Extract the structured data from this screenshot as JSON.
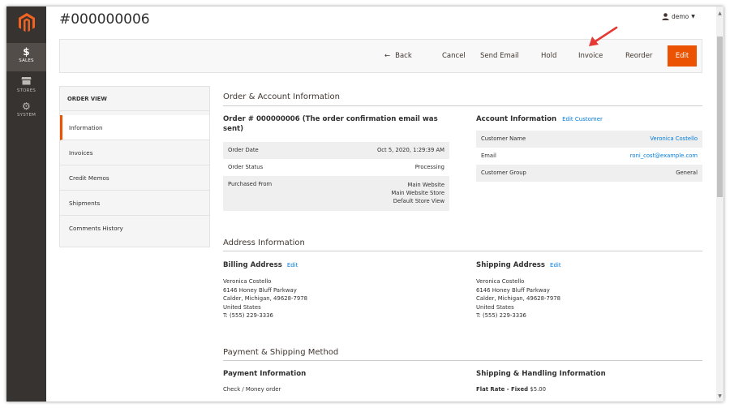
{
  "nav": {
    "items": [
      {
        "label": "SALES",
        "icon": "dollar-icon"
      },
      {
        "label": "STORES",
        "icon": "stores-icon"
      },
      {
        "label": "SYSTEM",
        "icon": "gear-icon"
      }
    ]
  },
  "header": {
    "title": "#000000006",
    "user": "demo"
  },
  "actions": {
    "back": "Back",
    "cancel": "Cancel",
    "send_email": "Send Email",
    "hold": "Hold",
    "invoice": "Invoice",
    "reorder": "Reorder",
    "edit": "Edit"
  },
  "tabs": {
    "title": "ORDER VIEW",
    "items": [
      "Information",
      "Invoices",
      "Credit Memos",
      "Shipments",
      "Comments History"
    ]
  },
  "order_account": {
    "section_title": "Order & Account Information",
    "order_heading_line1": "Order # 000000006 (The order confirmation email was",
    "order_heading_line2": "sent)",
    "order_rows": [
      {
        "label": "Order Date",
        "value": "Oct 5, 2020, 1:29:39 AM"
      },
      {
        "label": "Order Status",
        "value": "Processing"
      },
      {
        "label": "Purchased From",
        "value_lines": [
          "Main Website",
          "Main Website Store",
          "Default Store View"
        ]
      }
    ],
    "account_heading": "Account Information",
    "edit_customer": "Edit Customer",
    "account_rows": [
      {
        "label": "Customer Name",
        "value": "Veronica Costello"
      },
      {
        "label": "Email",
        "value": "roni_cost@example.com"
      },
      {
        "label": "Customer Group",
        "value": "General"
      }
    ]
  },
  "address": {
    "section_title": "Address Information",
    "billing_heading": "Billing Address",
    "shipping_heading": "Shipping Address",
    "edit_label": "Edit",
    "billing_lines": [
      "Veronica Costello",
      "6146 Honey Bluff Parkway",
      "Calder, Michigan, 49628-7978",
      "United States",
      "T: (555) 229-3336"
    ],
    "shipping_lines": [
      "Veronica Costello",
      "6146 Honey Bluff Parkway",
      "Calder, Michigan, 49628-7978",
      "United States",
      "T: (555) 229-3336"
    ]
  },
  "payment": {
    "section_title": "Payment & Shipping Method",
    "payment_heading": "Payment Information",
    "payment_method": "Check / Money order",
    "shipping_heading": "Shipping & Handling Information",
    "shipping_method": "Flat Rate - Fixed",
    "shipping_price": "$5.00"
  },
  "colors": {
    "accent": "#eb5202",
    "nav_bg": "#373330",
    "link": "#007bdb"
  }
}
